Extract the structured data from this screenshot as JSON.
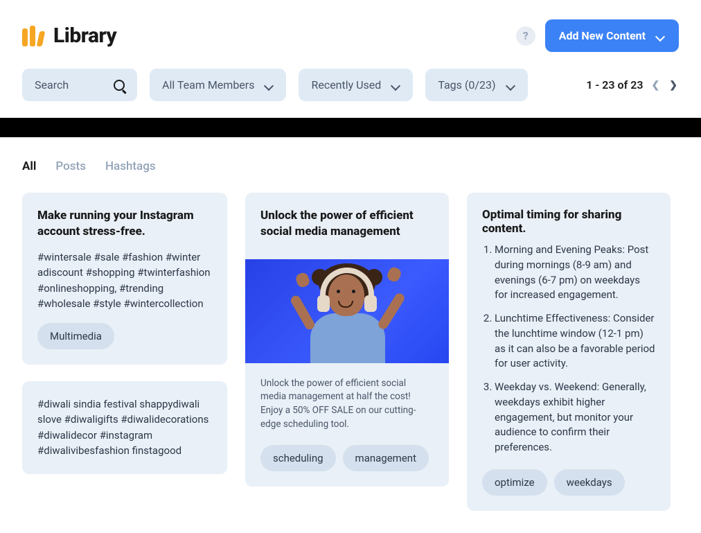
{
  "header": {
    "title": "Library",
    "help_label": "?",
    "add_button": "Add New Content"
  },
  "filters": {
    "search_placeholder": "Search",
    "team": "All Team Members",
    "sort": "Recently Used",
    "tags": "Tags (0/23)"
  },
  "pagination": {
    "text": "1 - 23 of 23"
  },
  "tabs": {
    "all": "All",
    "posts": "Posts",
    "hashtags": "Hashtags"
  },
  "cards": {
    "c1": {
      "title": "Make running your Instagram account stress-free.",
      "body": "#wintersale #sale #fashion #winter adiscount #shopping #twinterfashion #onlineshopping, #trending #wholesale #style #wintercollection",
      "pill1": "Multimedia"
    },
    "c1b": {
      "body": "#diwali sindia festival shappydiwali slove #diwaligifts #diwalidecorations #diwalidecor #instagram #diwalivibesfashion finstagood"
    },
    "c2": {
      "title": "Unlock the power of efficient social media management",
      "body": "Unlock the power of efficient social media management at half the cost!  Enjoy a 50% OFF SALE on our cutting-edge scheduling tool.",
      "pill1": "scheduling",
      "pill2": "management"
    },
    "c3": {
      "title": "Optimal timing for sharing content.",
      "li1": "Morning and Evening Peaks: Post during mornings (8-9 am) and evenings (6-7 pm) on weekdays for increased engagement.",
      "li2": "Lunchtime Effectiveness: Consider the lunchtime window (12-1 pm) as it can also be a favorable period for user activity.",
      "li3": "Weekday vs. Weekend: Generally, weekdays exhibit higher engagement, but monitor your audience to confirm their preferences.",
      "pill1": "optimize",
      "pill2": "weekdays"
    }
  }
}
